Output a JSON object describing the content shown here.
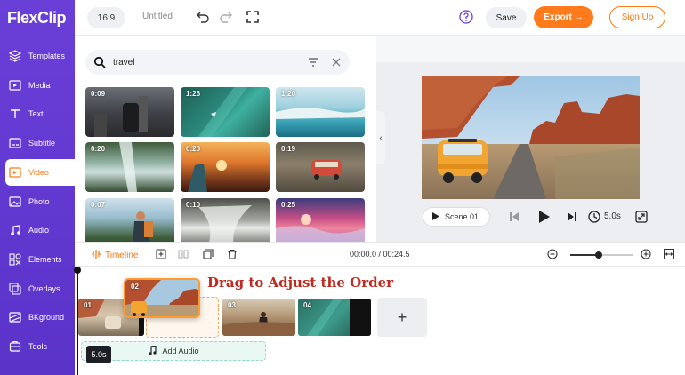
{
  "app": {
    "logo_text": "FlexClip"
  },
  "sidebar": {
    "items": [
      {
        "label": "Templates",
        "icon": "layers-icon"
      },
      {
        "label": "Media",
        "icon": "media-icon"
      },
      {
        "label": "Text",
        "icon": "text-icon"
      },
      {
        "label": "Subtitle",
        "icon": "subtitle-icon"
      },
      {
        "label": "Video",
        "icon": "video-icon",
        "active": true
      },
      {
        "label": "Photo",
        "icon": "photo-icon"
      },
      {
        "label": "Audio",
        "icon": "audio-icon"
      },
      {
        "label": "Elements",
        "icon": "elements-icon"
      },
      {
        "label": "Overlays",
        "icon": "overlays-icon"
      },
      {
        "label": "BKground",
        "icon": "background-icon"
      },
      {
        "label": "Tools",
        "icon": "tools-icon"
      }
    ]
  },
  "topbar": {
    "ratio": "16:9",
    "project_title": "Untitled",
    "save_label": "Save",
    "export_label": "Export →",
    "signup_label": "Sign Up"
  },
  "media_panel": {
    "search_value": "travel",
    "thumbnails": [
      {
        "duration": "0:09"
      },
      {
        "duration": "1:26"
      },
      {
        "duration": "1:20"
      },
      {
        "duration": "0:20"
      },
      {
        "duration": "0:20"
      },
      {
        "duration": "0:19"
      },
      {
        "duration": "0:07"
      },
      {
        "duration": "0:10"
      },
      {
        "duration": "0:25"
      }
    ]
  },
  "preview": {
    "scene_label": "Scene",
    "scene_number": "01",
    "duration": "5.0s"
  },
  "timeline": {
    "label": "Timeline",
    "timecode": "00:00.0 / 00:24.5",
    "zoom_level": 0.45,
    "clips": [
      {
        "number": "01"
      },
      {
        "number": "03"
      },
      {
        "number": "04"
      }
    ],
    "drag_clip_number": "02",
    "drag_hint": "Drag to Adjust the Order",
    "add_scene_label": "+",
    "add_audio_label": "Add Audio",
    "duration_badge": "5.0s"
  },
  "colors": {
    "sidebar": "#5a33c9",
    "accent": "#ff7a1a",
    "drag_hint": "#c0291f"
  }
}
